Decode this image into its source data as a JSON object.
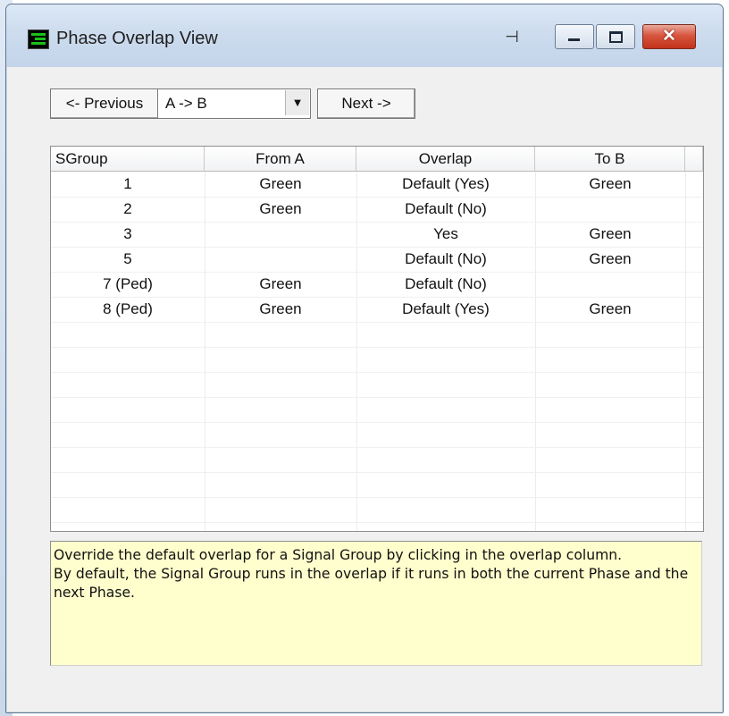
{
  "window": {
    "title": "Phase Overlap View",
    "app_icon": "traffic-signal-app-icon",
    "pin_icon": "pin-icon",
    "close_glyph": "✕"
  },
  "nav": {
    "previous_label": "<- Previous",
    "phase_select_value": "A -> B",
    "dropdown_glyph": "▼",
    "next_label": "Next ->"
  },
  "table": {
    "columns": [
      "SGroup",
      "From A",
      "Overlap",
      "To B"
    ],
    "rows": [
      {
        "sgroup": "1",
        "from": "Green",
        "overlap": "Default (Yes)",
        "to": "Green"
      },
      {
        "sgroup": "2",
        "from": "Green",
        "overlap": "Default (No)",
        "to": ""
      },
      {
        "sgroup": "3",
        "from": "",
        "overlap": "Yes",
        "to": "Green"
      },
      {
        "sgroup": "5",
        "from": "",
        "overlap": "Default (No)",
        "to": "Green"
      },
      {
        "sgroup": "7 (Ped)",
        "from": "Green",
        "overlap": "Default (No)",
        "to": ""
      },
      {
        "sgroup": "8 (Ped)",
        "from": "Green",
        "overlap": "Default (Yes)",
        "to": "Green"
      }
    ]
  },
  "help": {
    "line1": "Override the default overlap for a Signal Group by clicking in the overlap column.",
    "line2": "By default, the Signal Group runs in the overlap if it runs in both the current Phase and the next Phase."
  },
  "colors": {
    "help_background": "#fffecd",
    "close_button": "#c2321a",
    "titlebar": "#cddcee"
  }
}
